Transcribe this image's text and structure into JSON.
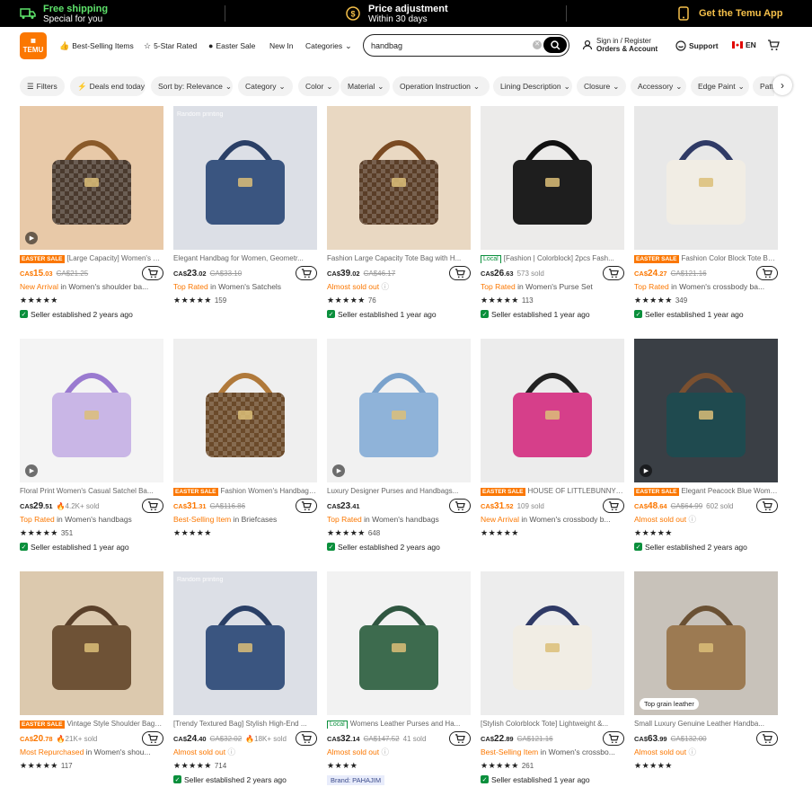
{
  "banner": {
    "shipping_title": "Free shipping",
    "shipping_sub": "Special for you",
    "price_title": "Price adjustment",
    "price_sub": "Within 30 days",
    "app_label": "Get the Temu App"
  },
  "header": {
    "logo_line1": "TEMU",
    "nav": [
      "Best-Selling Items",
      "5-Star Rated",
      "Easter Sale",
      "New In",
      "Categories"
    ],
    "search_value": "handbag",
    "signin_line1": "Sign in / Register",
    "signin_line2": "Orders & Account",
    "support": "Support",
    "lang": "EN"
  },
  "filters": [
    "Filters",
    "Deals end today",
    "Sort by: Relevance",
    "Category",
    "Color",
    "Material",
    "Operation Instruction",
    "Lining Description",
    "Closure",
    "Accessory",
    "Edge Paint",
    "Patt"
  ],
  "products": [
    {
      "sale": "EASTER SALE",
      "local": "",
      "title": "[Large Capacity] Women's PU...",
      "price_cur": "CA$",
      "price_int": "15",
      "price_dec": ".03",
      "orange": true,
      "orig": "CA$21.25",
      "sold": "",
      "fire": false,
      "sub_hl": "New Arrival",
      "sub_alm": "",
      "sub_rest": " in Women's shoulder ba...",
      "stars": "★★★★★",
      "reviews": "",
      "seller": "Seller established 2 years ago",
      "brand": "",
      "img_label": "",
      "play": true,
      "leather": ""
    },
    {
      "sale": "",
      "local": "",
      "title": "Elegant Handbag for Women, Geometr...",
      "price_cur": "CA$",
      "price_int": "23",
      "price_dec": ".02",
      "orange": false,
      "orig": "CA$33.10",
      "sold": "",
      "fire": false,
      "sub_hl": "Top Rated",
      "sub_alm": "",
      "sub_rest": " in Women's Satchels",
      "stars": "★★★★★",
      "reviews": "159",
      "seller": "",
      "brand": "",
      "img_label": "Random printing",
      "play": false,
      "leather": ""
    },
    {
      "sale": "",
      "local": "",
      "title": "Fashion Large Capacity Tote Bag with H...",
      "price_cur": "CA$",
      "price_int": "39",
      "price_dec": ".02",
      "orange": false,
      "orig": "CA$46.17",
      "sold": "",
      "fire": false,
      "sub_hl": "",
      "sub_alm": "Almost sold out",
      "sub_rest": "",
      "stars": "★★★★★",
      "reviews": "76",
      "seller": "Seller established 1 year ago",
      "brand": "",
      "img_label": "",
      "play": false,
      "leather": ""
    },
    {
      "sale": "",
      "local": "Local",
      "title": "[Fashion | Colorblock] 2pcs Fash...",
      "price_cur": "CA$",
      "price_int": "26",
      "price_dec": ".63",
      "orange": false,
      "orig": "",
      "sold": "573 sold",
      "fire": false,
      "sub_hl": "Top Rated",
      "sub_alm": "",
      "sub_rest": " in Women's Purse Set",
      "stars": "★★★★★",
      "reviews": "113",
      "seller": "Seller established 1 year ago",
      "brand": "",
      "img_label": "",
      "play": false,
      "leather": ""
    },
    {
      "sale": "EASTER SALE",
      "local": "",
      "title": "Fashion Color Block Tote Bag...",
      "price_cur": "CA$",
      "price_int": "24",
      "price_dec": ".27",
      "orange": true,
      "orig": "CA$121.16",
      "sold": "",
      "fire": false,
      "sub_hl": "Top Rated",
      "sub_alm": "",
      "sub_rest": " in Women's crossbody ba...",
      "stars": "★★★★★",
      "reviews": "349",
      "seller": "Seller established 1 year ago",
      "brand": "",
      "img_label": "",
      "play": false,
      "leather": ""
    },
    {
      "sale": "",
      "local": "",
      "title": "Floral Print Women's Casual Satchel Ba...",
      "price_cur": "CA$",
      "price_int": "29",
      "price_dec": ".51",
      "orange": false,
      "orig": "",
      "sold": "4.2K+ sold",
      "fire": true,
      "sub_hl": "Top Rated",
      "sub_alm": "",
      "sub_rest": " in Women's handbags",
      "stars": "★★★★★",
      "reviews": "351",
      "seller": "Seller established 1 year ago",
      "brand": "",
      "img_label": "",
      "play": true,
      "leather": ""
    },
    {
      "sale": "EASTER SALE",
      "local": "",
      "title": "Fashion Women's Handbag S...",
      "price_cur": "CA$",
      "price_int": "31",
      "price_dec": ".31",
      "orange": true,
      "orig": "CA$116.86",
      "sold": "",
      "fire": true,
      "sub_hl": "Best-Selling Item",
      "sub_alm": "",
      "sub_rest": " in Briefcases",
      "stars": "★★★★★",
      "reviews": "",
      "seller": "",
      "brand": "",
      "img_label": "",
      "play": false,
      "leather": ""
    },
    {
      "sale": "",
      "local": "",
      "title": "Luxury Designer Purses and Handbags...",
      "price_cur": "CA$",
      "price_int": "23",
      "price_dec": ".41",
      "orange": false,
      "orig": "",
      "sold": "",
      "fire": true,
      "sub_hl": "Top Rated",
      "sub_alm": "",
      "sub_rest": " in Women's handbags",
      "stars": "★★★★★",
      "reviews": "648",
      "seller": "Seller established 2 years ago",
      "brand": "",
      "img_label": "",
      "play": true,
      "leather": ""
    },
    {
      "sale": "EASTER SALE",
      "local": "",
      "title": "HOUSE OF LITTLEBUNNY Wh...",
      "price_cur": "CA$",
      "price_int": "31",
      "price_dec": ".52",
      "orange": true,
      "orig": "",
      "sold": "109 sold",
      "fire": false,
      "sub_hl": "New Arrival",
      "sub_alm": "",
      "sub_rest": " in Women's crossbody b...",
      "stars": "★★★★★",
      "reviews": "",
      "seller": "",
      "brand": "",
      "img_label": "",
      "play": false,
      "leather": ""
    },
    {
      "sale": "EASTER SALE",
      "local": "",
      "title": "Elegant Peacock Blue Wome...",
      "price_cur": "CA$",
      "price_int": "48",
      "price_dec": ".64",
      "orange": true,
      "orig": "CA$64.99",
      "sold": "602 sold",
      "fire": false,
      "sub_hl": "",
      "sub_alm": "Almost sold out",
      "sub_rest": "",
      "stars": "★★★★★",
      "reviews": "",
      "seller": "Seller established 2 years ago",
      "brand": "",
      "img_label": "",
      "play": true,
      "leather": ""
    },
    {
      "sale": "EASTER SALE",
      "local": "",
      "title": "Vintage Style Shoulder Bag f...",
      "price_cur": "CA$",
      "price_int": "20",
      "price_dec": ".78",
      "orange": true,
      "orig": "",
      "sold": "21K+ sold",
      "fire": true,
      "sub_hl": "Most Repurchased",
      "sub_alm": "",
      "sub_rest": " in Women's shou...",
      "stars": "★★★★★",
      "reviews": "117",
      "seller": "",
      "brand": "",
      "img_label": "",
      "play": false,
      "leather": ""
    },
    {
      "sale": "",
      "local": "",
      "title": "[Trendy Textured Bag] Stylish High-End ...",
      "price_cur": "CA$",
      "price_int": "24",
      "price_dec": ".40",
      "orange": false,
      "orig": "CA$32.02",
      "sold": "18K+ sold",
      "fire": true,
      "sub_hl": "",
      "sub_alm": "Almost sold out",
      "sub_rest": "",
      "stars": "★★★★★",
      "reviews": "714",
      "seller": "Seller established 2 years ago",
      "brand": "",
      "img_label": "Random printing",
      "play": false,
      "leather": ""
    },
    {
      "sale": "",
      "local": "Local",
      "title": "Womens Leather Purses and Ha...",
      "price_cur": "CA$",
      "price_int": "32",
      "price_dec": ".14",
      "orange": false,
      "orig": "CA$147.52",
      "sold": "41 sold",
      "fire": false,
      "sub_hl": "",
      "sub_alm": "Almost sold out",
      "sub_rest": "",
      "stars": "★★★★",
      "reviews": "",
      "seller": "",
      "brand": "Brand: PAHAJIM",
      "img_label": "",
      "play": false,
      "leather": ""
    },
    {
      "sale": "",
      "local": "",
      "title": "[Stylish Colorblock Tote] Lightweight &...",
      "price_cur": "CA$",
      "price_int": "22",
      "price_dec": ".89",
      "orange": false,
      "orig": "CA$121.16",
      "sold": "",
      "fire": false,
      "sub_hl": "Best-Selling Item",
      "sub_alm": "",
      "sub_rest": " in Women's crossbo...",
      "stars": "★★★★★",
      "reviews": "261",
      "seller": "Seller established 1 year ago",
      "brand": "",
      "img_label": "",
      "play": false,
      "leather": ""
    },
    {
      "sale": "",
      "local": "",
      "title": "Small Luxury Genuine Leather Handba...",
      "price_cur": "CA$",
      "price_int": "63",
      "price_dec": ".99",
      "orange": false,
      "orig": "CA$132.00",
      "sold": "",
      "fire": false,
      "sub_hl": "",
      "sub_alm": "Almost sold out",
      "sub_rest": "",
      "stars": "★★★★★",
      "reviews": "",
      "seller": "",
      "brand": "",
      "img_label": "",
      "play": false,
      "leather": "Top grain leather"
    }
  ]
}
